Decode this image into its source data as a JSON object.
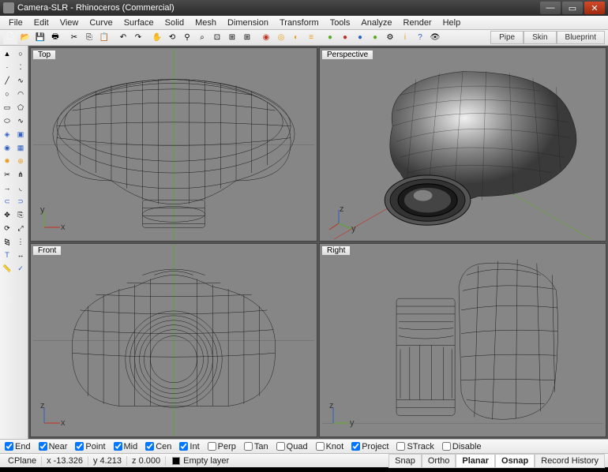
{
  "window": {
    "title": "Camera-SLR - Rhinoceros (Commercial)"
  },
  "menu": [
    "File",
    "Edit",
    "View",
    "Curve",
    "Surface",
    "Solid",
    "Mesh",
    "Dimension",
    "Transform",
    "Tools",
    "Analyze",
    "Render",
    "Help"
  ],
  "tabs": [
    "Pipe",
    "Skin",
    "Blueprint"
  ],
  "viewports": {
    "top": {
      "label": "Top"
    },
    "perspective": {
      "label": "Perspective"
    },
    "front": {
      "label": "Front"
    },
    "right": {
      "label": "Right"
    }
  },
  "osnap": {
    "end": {
      "label": "End",
      "checked": true
    },
    "near": {
      "label": "Near",
      "checked": true
    },
    "point": {
      "label": "Point",
      "checked": true
    },
    "mid": {
      "label": "Mid",
      "checked": true
    },
    "cen": {
      "label": "Cen",
      "checked": true
    },
    "int": {
      "label": "Int",
      "checked": true
    },
    "perp": {
      "label": "Perp",
      "checked": false
    },
    "tan": {
      "label": "Tan",
      "checked": false
    },
    "quad": {
      "label": "Quad",
      "checked": false
    },
    "knot": {
      "label": "Knot",
      "checked": false
    },
    "project": {
      "label": "Project",
      "checked": true
    },
    "strack": {
      "label": "STrack",
      "checked": false
    },
    "disable": {
      "label": "Disable",
      "checked": false
    }
  },
  "status": {
    "cplane": "CPlane",
    "x": "x -13.326",
    "y": "y 4.213",
    "z": "z 0.000",
    "layer": "Empty layer",
    "toggles": {
      "snap": {
        "label": "Snap",
        "on": false
      },
      "ortho": {
        "label": "Ortho",
        "on": false
      },
      "planar": {
        "label": "Planar",
        "on": true
      },
      "osnap": {
        "label": "Osnap",
        "on": true
      },
      "record": {
        "label": "Record History",
        "on": false
      }
    }
  },
  "colors": {
    "accent_green": "#5aaa2a",
    "accent_red": "#c03020",
    "accent_blue": "#3060c0"
  }
}
